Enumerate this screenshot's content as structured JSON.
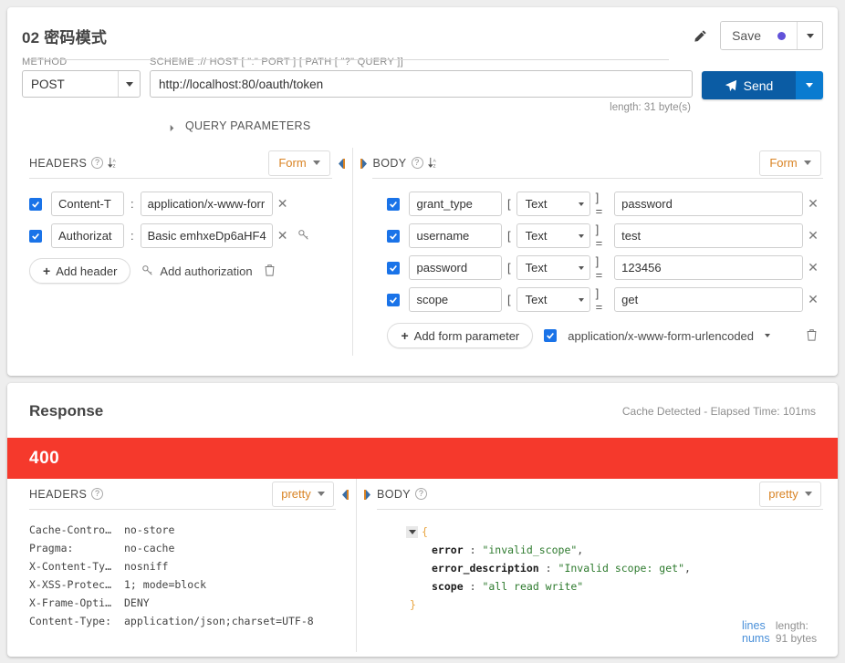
{
  "request": {
    "title": "02 密码模式",
    "edit_icon": "pencil-icon",
    "save": {
      "label": "Save",
      "dot_color": "#6152d9"
    },
    "method": {
      "label": "METHOD",
      "value": "POST"
    },
    "url": {
      "label": "SCHEME :// HOST [ \":\" PORT ] [ PATH [ \"?\" QUERY ]]",
      "value": "http://localhost:80/oauth/token",
      "length_text": "length: 31 byte(s)"
    },
    "send": {
      "label": "Send",
      "bg": "#0b5ca4",
      "caret_bg": "#0a7bd0"
    },
    "query_parameters_label": "QUERY PARAMETERS",
    "headers_pane": {
      "title": "HEADERS",
      "mode": "Form",
      "rows": [
        {
          "checked": true,
          "key": "Content-T",
          "value": "application/x-www-forr",
          "has_key_icon": false
        },
        {
          "checked": true,
          "key": "Authorizat",
          "value": "Basic emhxeDp6aHF4",
          "has_key_icon": true
        }
      ],
      "add_header_label": "Add header",
      "add_authorization_label": "Add authorization"
    },
    "body_pane": {
      "title": "BODY",
      "mode": "Form",
      "rows": [
        {
          "checked": true,
          "key": "grant_type",
          "type": "Text",
          "value": "password"
        },
        {
          "checked": true,
          "key": "username",
          "type": "Text",
          "value": "test"
        },
        {
          "checked": true,
          "key": "password",
          "type": "Text",
          "value": "123456"
        },
        {
          "checked": true,
          "key": "scope",
          "type": "Text",
          "value": "get"
        }
      ],
      "add_form_parameter_label": "Add form parameter",
      "content_type": {
        "checked": true,
        "label": "application/x-www-form-urlencoded"
      }
    }
  },
  "response": {
    "title": "Response",
    "meta": "Cache Detected - Elapsed Time: 101ms",
    "status_code": "400",
    "status_color": "#f5392c",
    "headers_pane": {
      "title": "HEADERS",
      "mode": "pretty",
      "rows": [
        {
          "name": "Cache-Contro…",
          "value": "no-store"
        },
        {
          "name": "Pragma:",
          "value": "no-cache"
        },
        {
          "name": "X-Content-Ty…",
          "value": "nosniff"
        },
        {
          "name": "X-XSS-Protec…",
          "value": "1; mode=block"
        },
        {
          "name": "X-Frame-Opti…",
          "value": "DENY"
        },
        {
          "name": "Content-Type:",
          "value": "application/json;charset=UTF-8"
        }
      ]
    },
    "body_pane": {
      "title": "BODY",
      "mode": "pretty",
      "json": {
        "open_brace": "{",
        "close_brace": "}",
        "entries": [
          {
            "key": "error",
            "colon": ":",
            "value": "\"invalid_scope\"",
            "comma": ","
          },
          {
            "key": "error_description",
            "colon": ":",
            "value": "\"Invalid scope: get\"",
            "comma": ","
          },
          {
            "key": "scope",
            "colon": ":",
            "value": "\"all read write\"",
            "comma": ""
          }
        ]
      },
      "lines_nums_label": "lines nums",
      "length_text": "length: 91 bytes"
    }
  }
}
